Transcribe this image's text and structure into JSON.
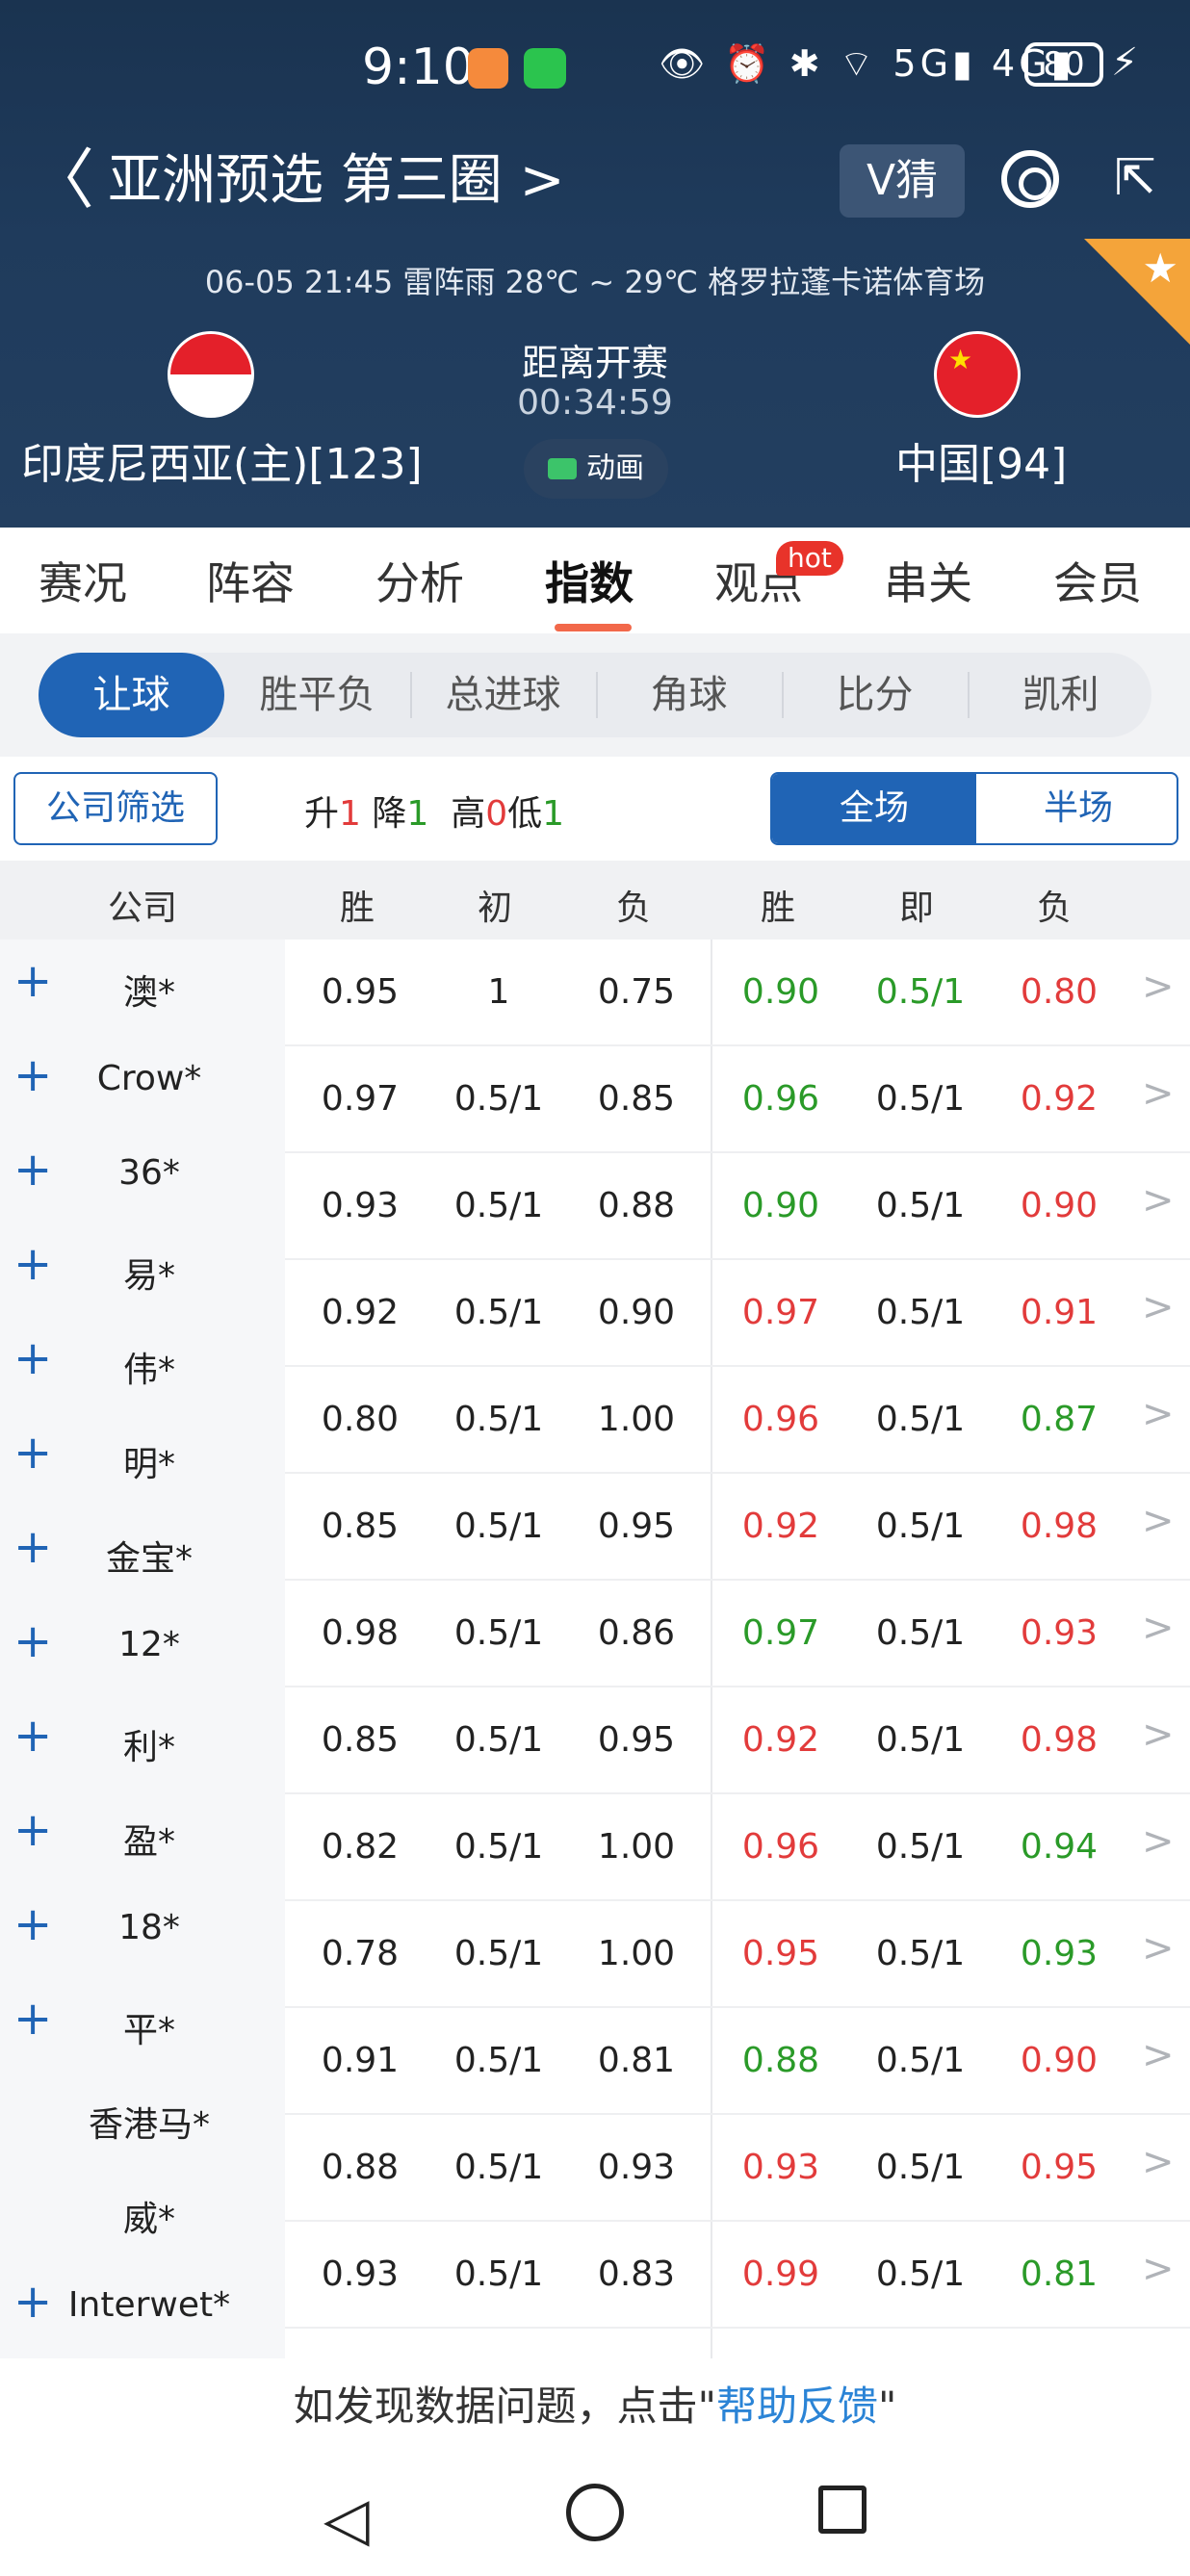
{
  "status_bar": {
    "time": "9:10",
    "icons_text": "👁 ⏰ ✱ ⌔ 5G▮ 4G▮",
    "battery": "80",
    "charging_symbol": "⚡"
  },
  "nav": {
    "back_symbol": "〈",
    "title": "亚洲预选 第三圈 >",
    "v_guess": "V猜",
    "share_symbol": "⇱"
  },
  "match": {
    "meta": "06-05 21:45   雷阵雨 28℃ ~ 29℃   格罗拉蓬卡诺体育场",
    "home_team": "印度尼西亚(主)[123]",
    "away_team": "中国[94]",
    "countdown_label": "距离开赛",
    "countdown_time": "00:34:59",
    "animation_label": "动画",
    "corner_star": "★",
    "cn_flag_stars": "★"
  },
  "tabs": [
    "赛况",
    "阵容",
    "分析",
    "指数",
    "观点",
    "串关",
    "会员"
  ],
  "hot_badge": "hot",
  "subtabs": [
    "让球",
    "胜平负",
    "总进球",
    "角球",
    "比分",
    "凯利"
  ],
  "filter": {
    "company_filter": "公司筛选",
    "up_label": "升",
    "up_count": "1",
    "down_label": "降",
    "down_count": "1",
    "high_label": "高",
    "high_count": "0",
    "low_label": "低",
    "low_count": "1",
    "full_match": "全场",
    "half_match": "半场"
  },
  "table": {
    "headers": [
      "公司",
      "胜",
      "初",
      "负",
      "胜",
      "即",
      "负"
    ],
    "plus_symbol": "+",
    "chevron_symbol": ">",
    "companies": [
      "澳*",
      "Crow*",
      "36*",
      "易*",
      "伟*",
      "明*",
      "金宝*",
      "12*",
      "利*",
      "盈*",
      "18*",
      "平*",
      "香港马*",
      "威*",
      "Interwet*"
    ],
    "rows": [
      {
        "init_win": "0.95",
        "init_line": "1",
        "init_lose": "0.75",
        "live_win": "0.90",
        "live_line": "0.5/1",
        "live_lose": "0.80"
      },
      {
        "init_win": "0.97",
        "init_line": "0.5/1",
        "init_lose": "0.85",
        "live_win": "0.96",
        "live_line": "0.5/1",
        "live_lose": "0.92"
      },
      {
        "init_win": "0.93",
        "init_line": "0.5/1",
        "init_lose": "0.88",
        "live_win": "0.90",
        "live_line": "0.5/1",
        "live_lose": "0.90"
      },
      {
        "init_win": "0.92",
        "init_line": "0.5/1",
        "init_lose": "0.90",
        "live_win": "0.97",
        "live_line": "0.5/1",
        "live_lose": "0.91"
      },
      {
        "init_win": "0.80",
        "init_line": "0.5/1",
        "init_lose": "1.00",
        "live_win": "0.96",
        "live_line": "0.5/1",
        "live_lose": "0.87"
      },
      {
        "init_win": "0.85",
        "init_line": "0.5/1",
        "init_lose": "0.95",
        "live_win": "0.92",
        "live_line": "0.5/1",
        "live_lose": "0.98"
      },
      {
        "init_win": "0.98",
        "init_line": "0.5/1",
        "init_lose": "0.86",
        "live_win": "0.97",
        "live_line": "0.5/1",
        "live_lose": "0.93"
      },
      {
        "init_win": "0.85",
        "init_line": "0.5/1",
        "init_lose": "0.95",
        "live_win": "0.92",
        "live_line": "0.5/1",
        "live_lose": "0.98"
      },
      {
        "init_win": "0.82",
        "init_line": "0.5/1",
        "init_lose": "1.00",
        "live_win": "0.96",
        "live_line": "0.5/1",
        "live_lose": "0.94"
      },
      {
        "init_win": "0.78",
        "init_line": "0.5/1",
        "init_lose": "1.00",
        "live_win": "0.95",
        "live_line": "0.5/1",
        "live_lose": "0.93"
      },
      {
        "init_win": "0.91",
        "init_line": "0.5/1",
        "init_lose": "0.81",
        "live_win": "0.88",
        "live_line": "0.5/1",
        "live_lose": "0.90"
      },
      {
        "init_win": "0.88",
        "init_line": "0.5/1",
        "init_lose": "0.93",
        "live_win": "0.93",
        "live_line": "0.5/1",
        "live_lose": "0.95"
      },
      {
        "init_win": "0.93",
        "init_line": "0.5/1",
        "init_lose": "0.83",
        "live_win": "0.99",
        "live_line": "0.5/1",
        "live_lose": "0.81"
      }
    ]
  },
  "footer": {
    "note_prefix": "如发现数据问题，点击\"",
    "link": "帮助反馈",
    "note_suffix": "\""
  },
  "colors": {
    "up": "#e23b3b",
    "down": "#2a9a28",
    "accent": "#2064b5",
    "header_bg": "#1f3b5c"
  }
}
